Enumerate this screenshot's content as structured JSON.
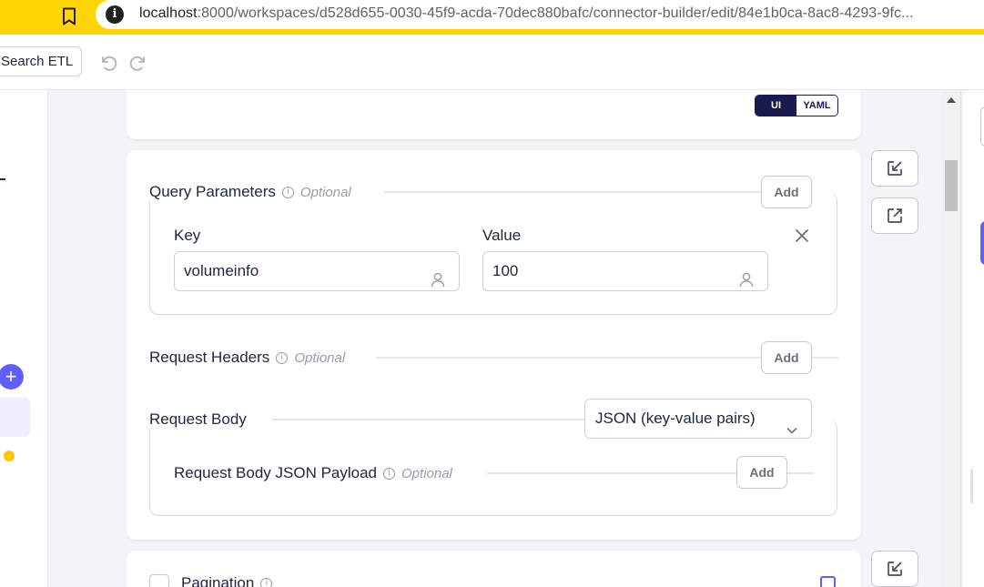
{
  "browser": {
    "url_host": "localhost",
    "url_path": ":8000/workspaces/d528d655-0030-45f9-acda-70dec880bafc/connector-builder/edit/84e1b0ca-8ac8-4293-9fc..."
  },
  "toolbar": {
    "search_label": "Search ETL"
  },
  "view_toggle": {
    "ui_label": "UI",
    "yaml_label": "YAML",
    "active": "UI"
  },
  "query_params": {
    "title": "Query Parameters",
    "optional": "Optional",
    "add_label": "Add",
    "key_label": "Key",
    "value_label": "Value",
    "key_value": "volumeinfo",
    "value_value": "100"
  },
  "request_headers": {
    "title": "Request Headers",
    "optional": "Optional",
    "add_label": "Add"
  },
  "request_body": {
    "title": "Request Body",
    "type_selected": "JSON (key-value pairs)",
    "payload_title": "Request Body JSON Payload",
    "optional": "Optional",
    "add_label": "Add"
  },
  "pagination": {
    "title": "Pagination"
  },
  "colors": {
    "accent": "#615eff",
    "browser_bar": "#ffd400",
    "dark_navy": "#1a1a4e"
  }
}
